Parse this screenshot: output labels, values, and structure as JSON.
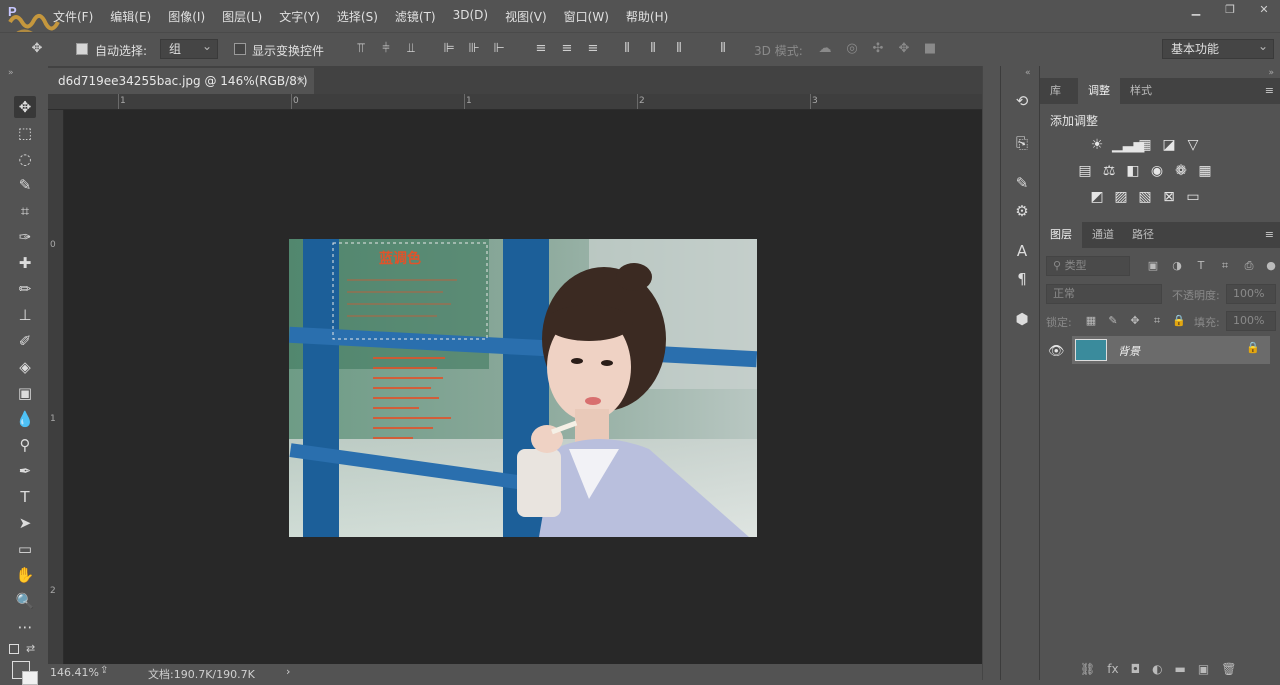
{
  "menubar": {
    "items": [
      "文件(F)",
      "编辑(E)",
      "图像(I)",
      "图层(L)",
      "文字(Y)",
      "选择(S)",
      "滤镜(T)",
      "3D(D)",
      "视图(V)",
      "窗口(W)",
      "帮助(H)"
    ],
    "logo_text": "P"
  },
  "optbar": {
    "auto_select_label": "自动选择:",
    "auto_select_value": "组",
    "show_transform_label": "显示变换控件",
    "mode3d_label": "3D 模式:",
    "workspace": "基本功能"
  },
  "document": {
    "tab_title": "d6d719ee34255bac.jpg @ 146%(RGB/8*) *",
    "tab_close": "×"
  },
  "rulers": {
    "top": [
      "1",
      "0",
      "1",
      "2",
      "3"
    ],
    "left": [
      "0",
      "1",
      "2"
    ]
  },
  "photo_overlay": {
    "title": "蓝调色"
  },
  "statusbar": {
    "zoom": "146.41%",
    "docinfo": "文档:190.7K/190.7K",
    "arrow": "›"
  },
  "rightpanel": {
    "top_tabs": [
      "库",
      "调整",
      "样式"
    ],
    "adjust_title": "添加调整",
    "layer_tabs": [
      "图层",
      "通道",
      "路径"
    ],
    "filter_placeholder": "类型",
    "blend_mode": "正常",
    "opacity_label": "不透明度:",
    "opacity_value": "100%",
    "lock_label": "锁定:",
    "fill_label": "填充:",
    "fill_value": "100%",
    "layer_name": "背景"
  },
  "colors": {
    "ui_bg": "#535353",
    "canvas_bg": "#282828",
    "photo_blue": "#1c5f99",
    "accent_red": "#e0532b"
  }
}
